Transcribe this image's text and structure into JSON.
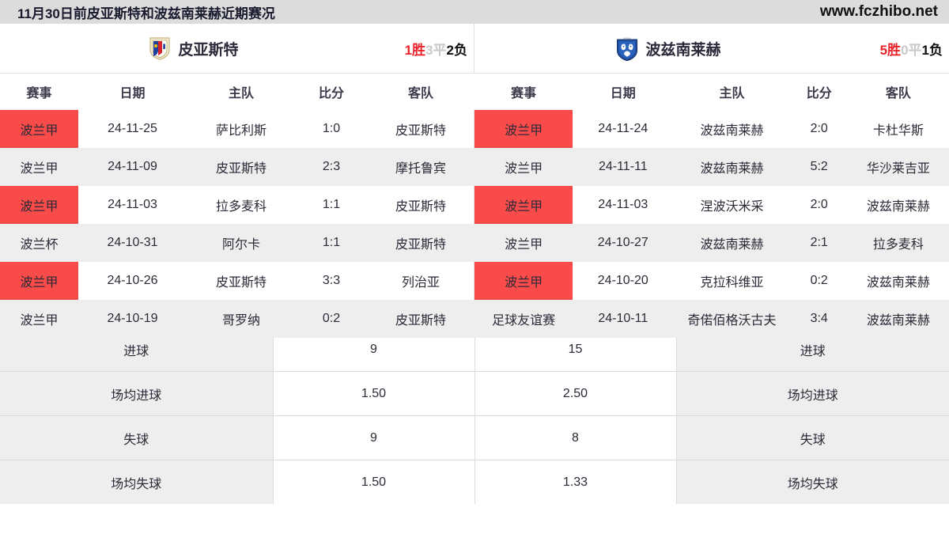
{
  "topbar": {
    "title": "11月30日前皮亚斯特和波兹南莱赫近期赛况",
    "site": "www.fczhibo.net"
  },
  "teams": {
    "left": {
      "name": "皮亚斯特",
      "crest": "piast-crest-icon",
      "record": {
        "wins": "1胜",
        "draws": "3平",
        "losses": "2负"
      }
    },
    "right": {
      "name": "波兹南莱赫",
      "crest": "lech-poznan-crest-icon",
      "record": {
        "wins": "5胜",
        "draws": "0平",
        "losses": "1负"
      }
    }
  },
  "columns": [
    "赛事",
    "日期",
    "主队",
    "比分",
    "客队"
  ],
  "left_matches": [
    {
      "league": "波兰甲",
      "date": "24-11-25",
      "home": "萨比利斯",
      "score": "1:0",
      "away": "皮亚斯特"
    },
    {
      "league": "波兰甲",
      "date": "24-11-09",
      "home": "皮亚斯特",
      "score": "2:3",
      "away": "摩托鲁宾"
    },
    {
      "league": "波兰甲",
      "date": "24-11-03",
      "home": "拉多麦科",
      "score": "1:1",
      "away": "皮亚斯特"
    },
    {
      "league": "波兰杯",
      "date": "24-10-31",
      "home": "阿尔卡",
      "score": "1:1",
      "away": "皮亚斯特"
    },
    {
      "league": "波兰甲",
      "date": "24-10-26",
      "home": "皮亚斯特",
      "score": "3:3",
      "away": "列治亚"
    },
    {
      "league": "波兰甲",
      "date": "24-10-19",
      "home": "哥罗纳",
      "score": "0:2",
      "away": "皮亚斯特"
    }
  ],
  "right_matches": [
    {
      "league": "波兰甲",
      "date": "24-11-24",
      "home": "波兹南莱赫",
      "score": "2:0",
      "away": "卡杜华斯"
    },
    {
      "league": "波兰甲",
      "date": "24-11-11",
      "home": "波兹南莱赫",
      "score": "5:2",
      "away": "华沙莱吉亚"
    },
    {
      "league": "波兰甲",
      "date": "24-11-03",
      "home": "涅波沃米采",
      "score": "2:0",
      "away": "波兹南莱赫"
    },
    {
      "league": "波兰甲",
      "date": "24-10-27",
      "home": "波兹南莱赫",
      "score": "2:1",
      "away": "拉多麦科"
    },
    {
      "league": "波兰甲",
      "date": "24-10-20",
      "home": "克拉科维亚",
      "score": "0:2",
      "away": "波兹南莱赫"
    },
    {
      "league": "足球友谊赛",
      "date": "24-10-11",
      "home": "奇偌佰格沃古夫",
      "score": "3:4",
      "away": "波兹南莱赫"
    }
  ],
  "stats": [
    {
      "label_left": "进球",
      "value_left": "9",
      "value_right": "15",
      "label_right": "进球"
    },
    {
      "label_left": "场均进球",
      "value_left": "1.50",
      "value_right": "2.50",
      "label_right": "场均进球"
    },
    {
      "label_left": "失球",
      "value_left": "9",
      "value_right": "8",
      "label_right": "失球"
    },
    {
      "label_left": "场均失球",
      "value_left": "1.50",
      "value_right": "1.33",
      "label_right": "场均失球"
    }
  ],
  "colors": {
    "league_badge": "#fa4b4b",
    "league_badge_alt": "#e83636",
    "win": "#e8242a",
    "draw": "#c9c9c9",
    "loss": "#111111",
    "row_alt": "#eeeeee",
    "topbar_bg": "#dcdcdc"
  }
}
